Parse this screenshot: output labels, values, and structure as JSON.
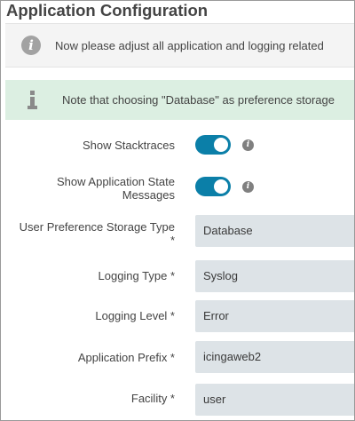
{
  "page": {
    "title": "Application Configuration"
  },
  "info": {
    "icon": "info-icon",
    "text": "Now please adjust all application and logging related"
  },
  "note": {
    "icon": "info-icon",
    "text": "Note that choosing \"Database\" as preference storage"
  },
  "form": {
    "show_stacktraces": {
      "label": "Show Stacktraces",
      "enabled": true,
      "help_icon": "info-icon"
    },
    "show_app_state": {
      "label_line1": "Show Application State",
      "label_line2": "Messages",
      "enabled": true,
      "help_icon": "info-icon"
    },
    "preference_storage": {
      "label_line1": "User Preference Storage Type",
      "label_line2": "*",
      "value": "Database"
    },
    "logging_type": {
      "label": "Logging Type *",
      "value": "Syslog"
    },
    "logging_level": {
      "label": "Logging Level *",
      "value": "Error"
    },
    "application_prefix": {
      "label": "Application Prefix *",
      "value": "icingaweb2"
    },
    "facility": {
      "label": "Facility *",
      "value": "user"
    }
  },
  "colors": {
    "toggle_on": "#0b7fa8",
    "field_bg": "#dde3e7",
    "note_bg": "#dcefe2",
    "info_bg": "#f4f4f4"
  }
}
